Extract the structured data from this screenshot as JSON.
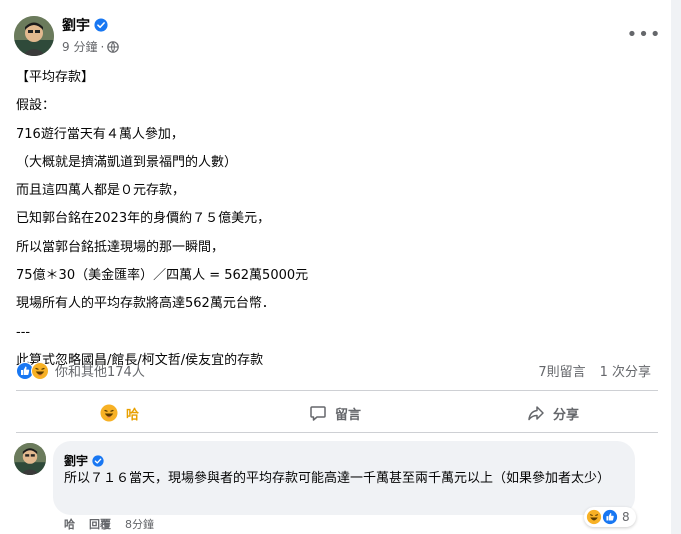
{
  "post": {
    "author": "劉宇",
    "time": "9 分鐘",
    "lines": [
      "【平均存款】",
      "假設：",
      "716遊行當天有４萬人參加，",
      "（大概就是擠滿凱道到景福門的人數）",
      "而且這四萬人都是０元存款，",
      "已知郭台銘在2023年的身價約７５億美元，",
      "所以當郭台銘抵達現場的那一瞬間，",
      "75億＊30（美金匯率）／四萬人 = 562萬5000元",
      "現場所有人的平均存款將高達562萬元台幣．",
      "---",
      "此算式忽略國昌/館長/柯文哲/侯友宜的存款"
    ],
    "reactions_text": "你和其他174人",
    "comments_count": "7則留言",
    "shares_count": "1 次分享"
  },
  "actions": {
    "haha_label": "哈",
    "comment_label": "留言",
    "share_label": "分享"
  },
  "comment": {
    "author": "劉宇",
    "text": "所以７１６當天，現場參與者的平均存款可能高達一千萬甚至兩千萬元以上（如果參加者太少）",
    "reaction_count": "8",
    "like_label": "哈",
    "reply_label": "回覆",
    "time": "8分鐘"
  },
  "colors": {
    "verified_blue": "#1877f2",
    "haha_yellow": "#f7b125",
    "like_blue": "#1877f2",
    "muted_text": "#65676b"
  }
}
